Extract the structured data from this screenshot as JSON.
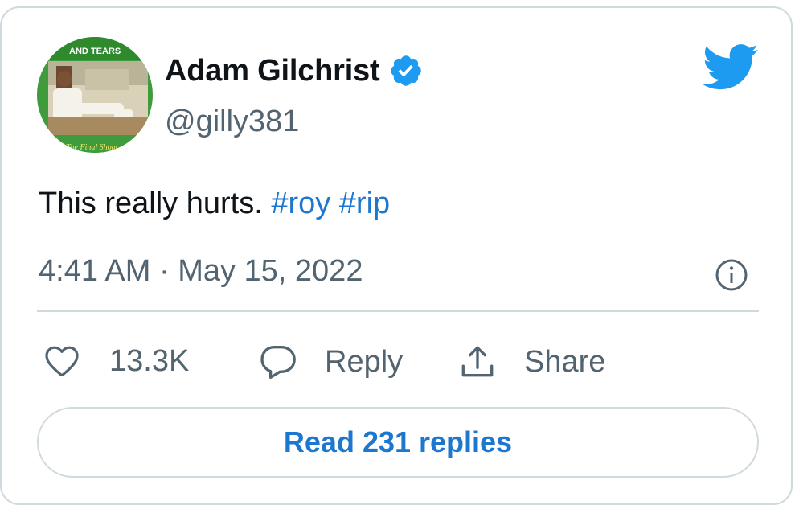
{
  "author": {
    "name": "Adam Gilchrist",
    "handle": "@gilly381",
    "verified": true,
    "avatar_text_top": "AND TEARS",
    "avatar_text_bottom": "The Final Shout"
  },
  "tweet": {
    "text": "This really hurts.",
    "hashtags": [
      "#roy",
      "#rip"
    ],
    "timestamp": "4:41 AM · May 15, 2022"
  },
  "actions": {
    "likes": "13.3K",
    "reply": "Reply",
    "share": "Share"
  },
  "read_replies": "Read 231 replies",
  "colors": {
    "twitter_blue": "#1d9bf0",
    "link_blue": "#1d77cf",
    "text_primary": "#0f1419",
    "text_secondary": "#536471",
    "border": "#cfd9de"
  },
  "icons": [
    "twitter-bird-icon",
    "verified-badge-icon",
    "info-icon",
    "heart-icon",
    "reply-bubble-icon",
    "share-icon"
  ]
}
